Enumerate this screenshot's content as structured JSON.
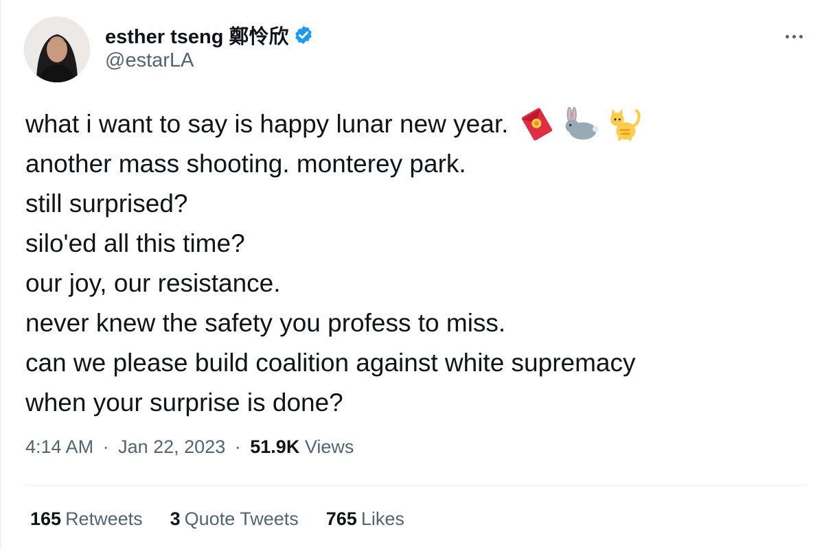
{
  "author": {
    "display_name": "esther tseng 鄭怜欣",
    "handle": "@estarLA",
    "verified": true
  },
  "tweet": {
    "lines": [
      "what i want to say is happy lunar new year.",
      "another mass shooting. monterey park.",
      "still surprised?",
      "silo'ed all this time?",
      "our joy, our resistance.",
      "never knew the safety you profess to miss.",
      "can we please build coalition against white supremacy",
      "when your surprise is done?"
    ],
    "emojis": [
      "red-envelope-icon",
      "rabbit-icon",
      "cat-icon"
    ]
  },
  "meta": {
    "time": "4:14 AM",
    "separator": "·",
    "date": "Jan 22, 2023",
    "views_count": "51.9K",
    "views_label": "Views"
  },
  "stats": {
    "retweets_count": "165",
    "retweets_label": "Retweets",
    "quotes_count": "3",
    "quotes_label": "Quote Tweets",
    "likes_count": "765",
    "likes_label": "Likes"
  },
  "colors": {
    "text": "#0f1419",
    "secondary": "#536471",
    "verified": "#1d9bf0",
    "divider": "#eff3f4"
  }
}
